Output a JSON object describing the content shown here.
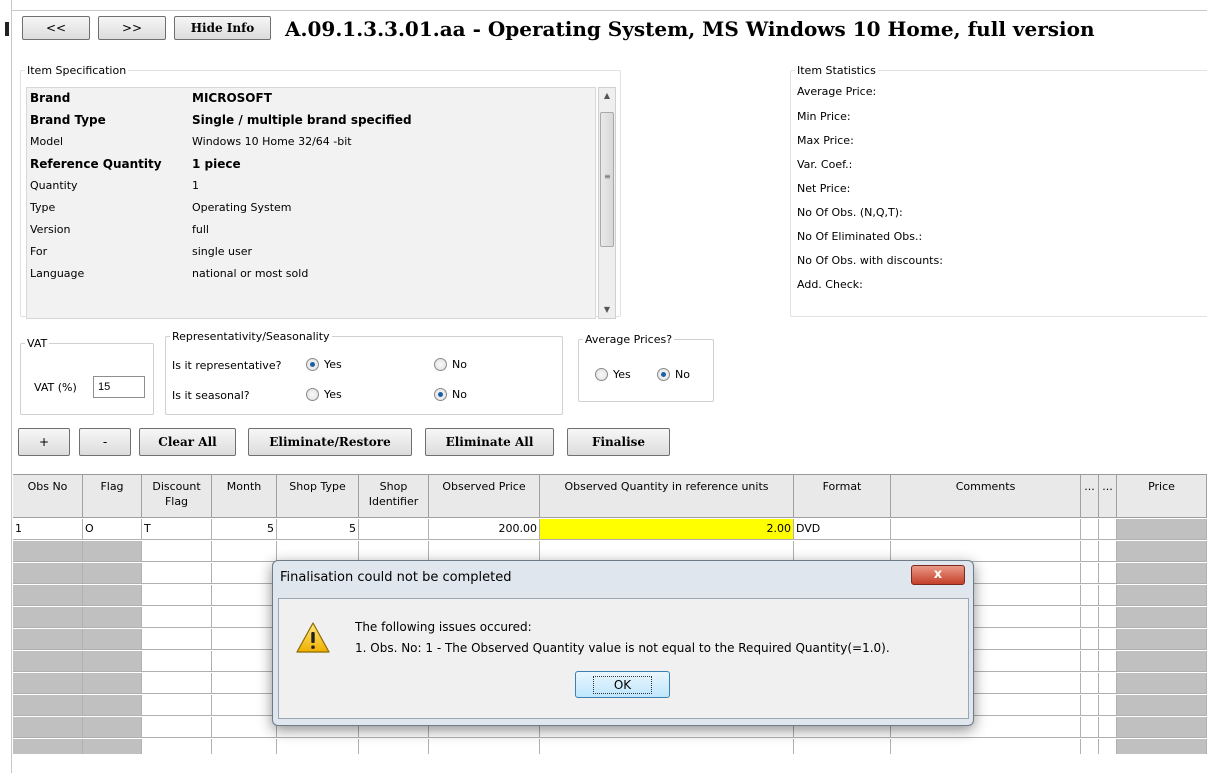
{
  "toolbar": {
    "prev_label": "<<",
    "next_label": ">>",
    "hide_info_label": "Hide Info",
    "title": "A.09.1.3.3.01.aa - Operating System, MS Windows 10 Home, full version"
  },
  "item_spec": {
    "legend": "Item Specification",
    "rows": [
      {
        "key": "Brand",
        "value": "MICROSOFT",
        "bold": true
      },
      {
        "key": "Brand Type",
        "value": "Single / multiple brand specified",
        "bold": true
      },
      {
        "key": "Model",
        "value": "Windows 10 Home 32/64 -bit",
        "bold": false
      },
      {
        "key": "Reference Quantity",
        "value": "1 piece",
        "bold": true
      },
      {
        "key": "Quantity",
        "value": "1",
        "bold": false
      },
      {
        "key": "Type",
        "value": "Operating System",
        "bold": false
      },
      {
        "key": "Version",
        "value": "full",
        "bold": false
      },
      {
        "key": "For",
        "value": "single user",
        "bold": false
      },
      {
        "key": "Language",
        "value": "national or most sold",
        "bold": false
      }
    ]
  },
  "item_stats": {
    "legend": "Item Statistics",
    "rows": [
      "Average Price:",
      "Min Price:",
      "Max Price:",
      "Var. Coef.:",
      "Net Price:",
      "No Of Obs. (N,Q,T):",
      "No Of Eliminated Obs.:",
      "No Of Obs. with discounts:",
      "Add. Check:"
    ]
  },
  "vat": {
    "legend": "VAT",
    "label": "VAT (%)",
    "value": "15"
  },
  "representativity": {
    "legend": "Representativity/Seasonality",
    "q1": "Is it representative?",
    "q2": "Is it seasonal?",
    "yes": "Yes",
    "no": "No",
    "representative": "Yes",
    "seasonal": "No"
  },
  "average_prices": {
    "legend": "Average Prices?",
    "yes": "Yes",
    "no": "No",
    "selected": "No"
  },
  "actions": {
    "add": "+",
    "remove": "-",
    "clear_all": "Clear All",
    "eliminate_restore": "Eliminate/Restore",
    "eliminate_all": "Eliminate All",
    "finalise": "Finalise"
  },
  "grid": {
    "headers": [
      "Obs No",
      "Flag",
      "Discount Flag",
      "Month",
      "Shop Type",
      "Shop Identifier",
      "Observed Price",
      "Observed Quantity in reference units",
      "Format",
      "Comments",
      "...",
      "...",
      "Price"
    ],
    "rows": [
      {
        "obs_no": "1",
        "flag": "O",
        "discount_flag": "T",
        "month": "5",
        "shop_type": "5",
        "shop_identifier": "",
        "observed_price": "200.00",
        "observed_quantity": "2.00",
        "format": "DVD",
        "comments": ""
      }
    ]
  },
  "dialog": {
    "title": "Finalisation could not be completed",
    "close": "x",
    "line1": "The following issues occured:",
    "line2": "1. Obs. No: 1 - The Observed Quantity value is not equal to the Required Quantity(=1.0).",
    "ok": "OK"
  },
  "colors": {
    "highlight": "#ffff00",
    "disabled_cell": "#c0c0c0"
  }
}
